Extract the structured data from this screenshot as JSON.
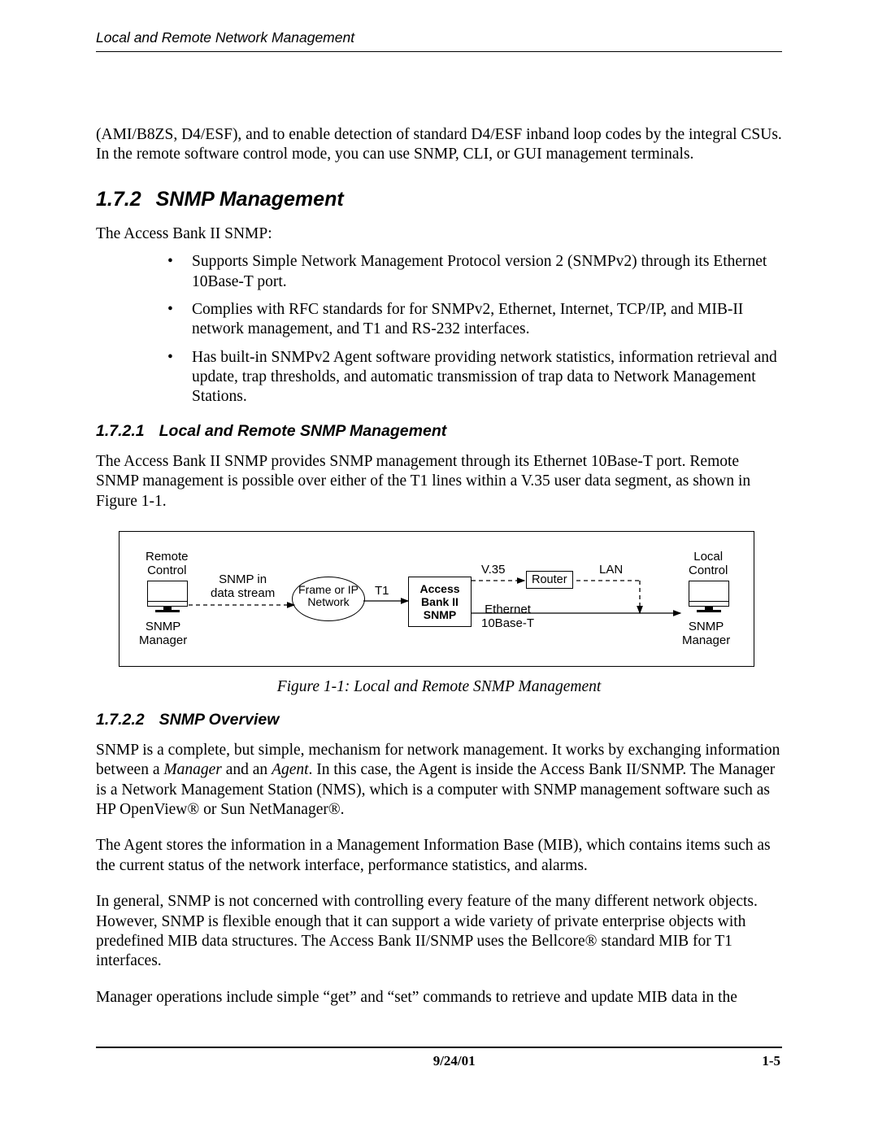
{
  "header": {
    "running_title": "Local and Remote Network Management"
  },
  "intro_para": "(AMI/B8ZS, D4/ESF), and to enable detection of standard D4/ESF inband loop codes by the integral CSUs. In the remote software control mode, you can use SNMP, CLI, or GUI management terminals.",
  "s172": {
    "num": "1.7.2",
    "title": "SNMP Management",
    "lead": "The Access Bank II SNMP:",
    "bullets": [
      "Supports Simple Network Management Protocol version 2 (SNMPv2) through its Ethernet 10Base-T port.",
      "Complies with RFC standards for for SNMPv2, Ethernet, Internet, TCP/IP, and MIB-II network management, and T1 and RS-232 interfaces.",
      "Has built-in SNMPv2 Agent software providing network statistics, information retrieval and update, trap thresholds, and automatic transmission of trap data to Network Management Stations."
    ]
  },
  "s1721": {
    "num": "1.7.2.1",
    "title": "Local and Remote SNMP Management",
    "para": "The Access Bank II SNMP provides SNMP management through its Ethernet 10Base-T port. Remote SNMP management is possible over either of the T1 lines within a V.35 user data segment, as shown in Figure 1-1."
  },
  "figure": {
    "caption": "Figure 1-1: Local and Remote SNMP Management",
    "labels": {
      "remote_control": "Remote\nControl",
      "snmp_in": "SNMP in\ndata stream",
      "cloud": "Frame\nor IP\nNetwork",
      "t1": "T1",
      "device": "Access\nBank II\nSNMP",
      "v35": "V.35",
      "router": "Router",
      "lan": "LAN",
      "ethernet": "Ethernet\n10Base-T",
      "local_control": "Local\nControl",
      "snmp_mgr_left": "SNMP\nManager",
      "snmp_mgr_right": "SNMP\nManager"
    }
  },
  "s1722": {
    "num": "1.7.2.2",
    "title": "SNMP Overview",
    "p1_a": "SNMP is a complete, but simple, mechanism for network management. It works by exchanging information between a ",
    "p1_i1": "Manager",
    "p1_b": " and an ",
    "p1_i2": "Agent",
    "p1_c": ". In this case, the Agent is inside the Access Bank II/SNMP. The Manager is a Network Management Station (NMS), which is a computer with SNMP management software such as HP OpenView® or Sun NetManager®.",
    "p2": "The Agent stores the information in a Management Information Base (MIB), which contains items such as the current status of the network interface, performance statistics, and alarms.",
    "p3": "In general, SNMP is not concerned with controlling every feature of the many different network objects. However, SNMP is flexible enough that it can support a wide variety of private enterprise objects with predefined MIB data structures. The Access Bank II/SNMP uses the Bellcore® standard MIB for T1 interfaces.",
    "p4": "Manager operations include simple “get” and “set” commands to retrieve and update MIB data in the"
  },
  "footer": {
    "date": "9/24/01",
    "page": "1-5"
  }
}
